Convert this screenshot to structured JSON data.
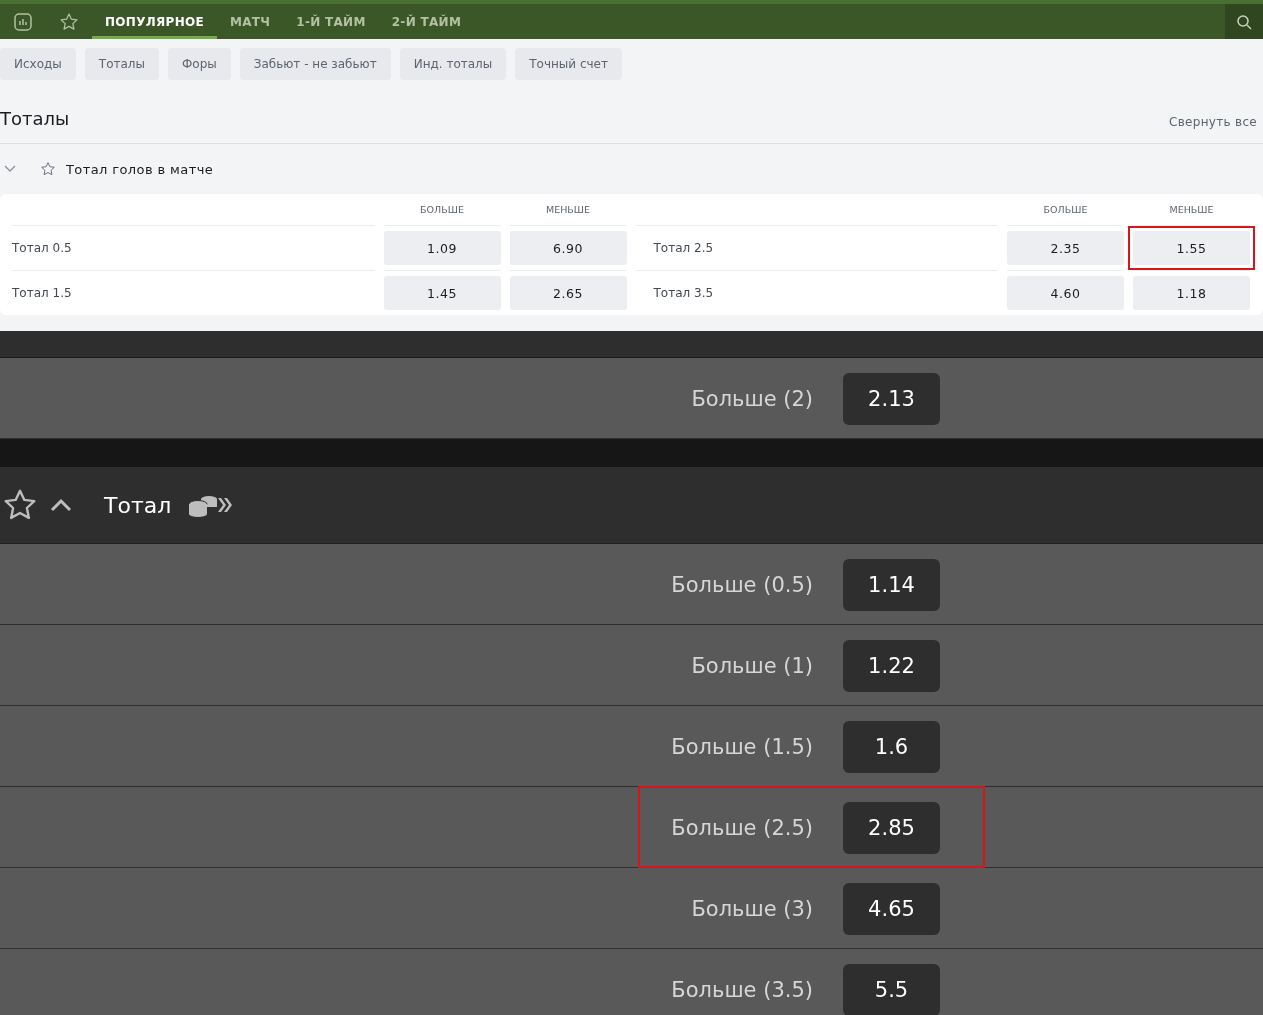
{
  "nav": {
    "tabs": [
      {
        "label": "ПОПУЛЯРНОЕ",
        "selected": true
      },
      {
        "label": "МАТЧ",
        "selected": false
      },
      {
        "label": "1-Й ТАЙМ",
        "selected": false
      },
      {
        "label": "2-Й ТАЙМ",
        "selected": false
      }
    ]
  },
  "filters": [
    "Исходы",
    "Тоталы",
    "Форы",
    "Забьют - не забьют",
    "Инд. тоталы",
    "Точный счет"
  ],
  "section": {
    "title": "Тоталы",
    "collapse_link": "Свернуть все"
  },
  "market": {
    "title": "Тотал голов в матче",
    "columns": [
      "",
      "БОЛЬШЕ",
      "МЕНЬШЕ",
      "",
      "БОЛЬШЕ",
      "МЕНЬШЕ"
    ],
    "rows": [
      {
        "cells": [
          {
            "kind": "label",
            "text": "Тотал 0.5"
          },
          {
            "kind": "odd",
            "text": "1.09",
            "highlighted": false
          },
          {
            "kind": "odd",
            "text": "6.90",
            "highlighted": false
          },
          {
            "kind": "label",
            "text": "Тотал 2.5"
          },
          {
            "kind": "odd",
            "text": "2.35",
            "highlighted": false
          },
          {
            "kind": "odd",
            "text": "1.55",
            "highlighted": true
          }
        ]
      },
      {
        "cells": [
          {
            "kind": "label",
            "text": "Тотал 1.5"
          },
          {
            "kind": "odd",
            "text": "1.45",
            "highlighted": false
          },
          {
            "kind": "odd",
            "text": "2.65",
            "highlighted": false
          },
          {
            "kind": "label",
            "text": "Тотал 3.5"
          },
          {
            "kind": "odd",
            "text": "4.60",
            "highlighted": false
          },
          {
            "kind": "odd",
            "text": "1.18",
            "highlighted": false
          }
        ]
      }
    ]
  },
  "dark_top_row": {
    "label": "Больше (2)",
    "odd": "2.13",
    "highlighted": false
  },
  "dark_market": {
    "title": "Тотал",
    "expanded": true,
    "rows": [
      {
        "label": "Больше (0.5)",
        "odd": "1.14",
        "highlighted": false
      },
      {
        "label": "Больше (1)",
        "odd": "1.22",
        "highlighted": false
      },
      {
        "label": "Больше (1.5)",
        "odd": "1.6",
        "highlighted": false
      },
      {
        "label": "Больше (2.5)",
        "odd": "2.85",
        "highlighted": true
      },
      {
        "label": "Больше (3)",
        "odd": "4.65",
        "highlighted": false
      },
      {
        "label": "Больше (3.5)",
        "odd": "5.5",
        "highlighted": false
      }
    ]
  }
}
